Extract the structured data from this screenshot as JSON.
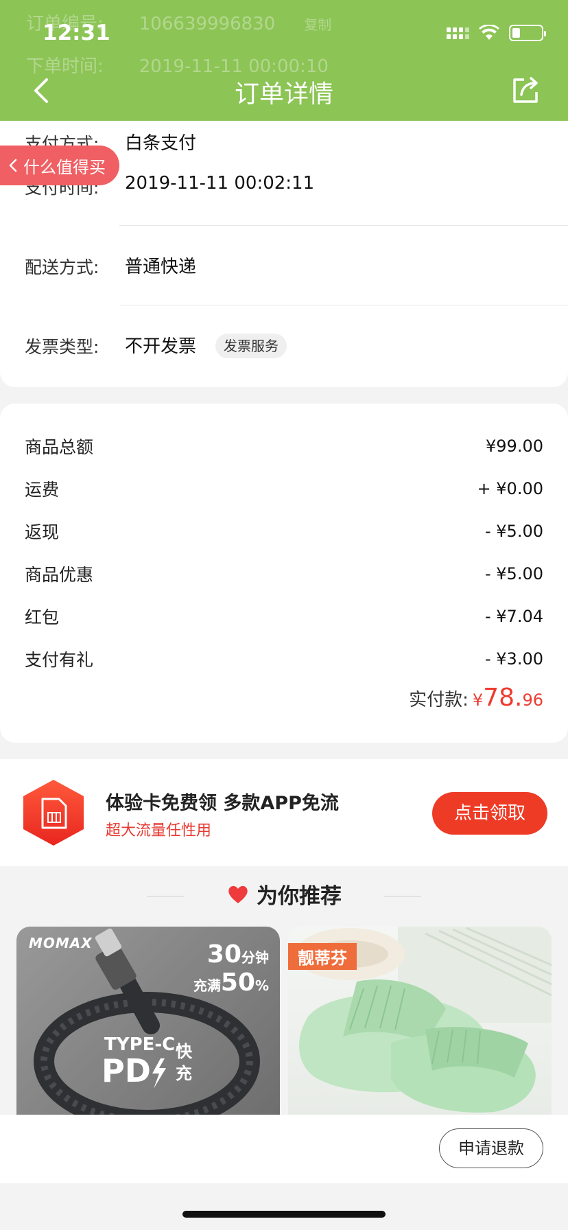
{
  "status_bar": {
    "time": "12:31"
  },
  "header": {
    "title": "订单详情",
    "ghost_rows": [
      {
        "label": "订单编号:",
        "value": "106639996830",
        "action": "复制"
      },
      {
        "label": "下单时间:",
        "value": "2019-11-11 00:00:10"
      }
    ]
  },
  "floating_tag": {
    "label": "什么值得买"
  },
  "order_info": {
    "pay_method": {
      "label": "支付方式:",
      "value": "白条支付"
    },
    "pay_time": {
      "label": "支付时间:",
      "value": "2019-11-11 00:02:11"
    },
    "delivery": {
      "label": "配送方式:",
      "value": "普通快递"
    },
    "invoice": {
      "label": "发票类型:",
      "value": "不开发票",
      "chip": "发票服务"
    }
  },
  "fees": {
    "rows": [
      {
        "label": "商品总额",
        "amount": "¥99.00"
      },
      {
        "label": "运费",
        "amount": "+ ¥0.00"
      },
      {
        "label": "返现",
        "amount": "- ¥5.00"
      },
      {
        "label": "商品优惠",
        "amount": "- ¥5.00"
      },
      {
        "label": "红包",
        "amount": "- ¥7.04"
      },
      {
        "label": "支付有礼",
        "amount": "- ¥3.00"
      }
    ],
    "paid_label": "实付款:",
    "paid_currency": "¥",
    "paid_int": "78.",
    "paid_dec": "96"
  },
  "promo": {
    "title": "体验卡免费领 多款APP免流",
    "subtitle": "超大流量任性用",
    "button": "点击领取"
  },
  "recommend": {
    "title": "为你推荐",
    "products": [
      {
        "brand": "MOMAX",
        "tag_big": "30",
        "tag_unit": "分钟",
        "tag_line2": "充满",
        "tag_pct": "50",
        "tag_pct_unit": "%",
        "cable_text1": "TYPE-C",
        "cable_text2": "PD",
        "cable_text3": "快",
        "cable_text4": "充"
      },
      {
        "brand": "靓蒂芬"
      }
    ]
  },
  "bottom": {
    "refund_button": "申请退款"
  },
  "colors": {
    "header_green": "#8cc456",
    "accent_red": "#ee3b2f",
    "pill_red": "#f05f63"
  }
}
